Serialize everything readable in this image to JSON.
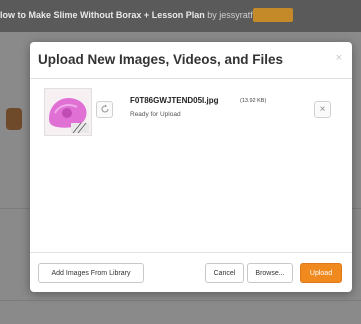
{
  "background_page": {
    "title": "low to Make Slime Without Borax + Lesson Plan",
    "author_prefix": "by",
    "author": "jessyratfink"
  },
  "modal": {
    "title": "Upload New Images, Videos, and Files",
    "close_symbol": "×",
    "file": {
      "name": "F0T86GWJTEND05I.jpg",
      "size": "(13.92 KB)",
      "status": "Ready for Upload",
      "remove_symbol": "×"
    },
    "buttons": {
      "add_from_library": "Add Images From Library",
      "cancel": "Cancel",
      "browse": "Browse...",
      "upload": "Upload"
    }
  },
  "colors": {
    "accent": "#f08a1f",
    "overlay": "#8a8a8a"
  },
  "icons": {
    "refresh": "refresh-icon",
    "remove": "close-icon",
    "modal_close": "close-icon"
  }
}
